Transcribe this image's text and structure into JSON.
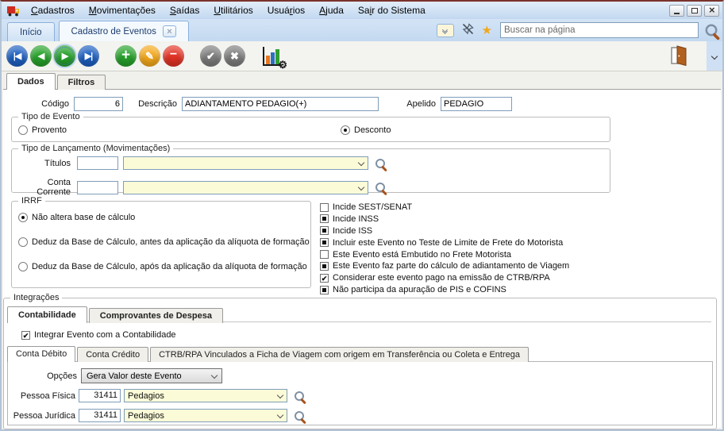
{
  "colors": {
    "window_border": "#7a332c",
    "titlebar_blue": "#cfe2f5",
    "link_navy": "#1c3d6e",
    "nav_blue": "#1d5fc0",
    "nav_green": "#27a12b",
    "edit_orange": "#f3a81c",
    "delete_red": "#e23325",
    "neutral_gray": "#7d7d7d",
    "input_yellow": "#fbfbd8",
    "star_gold": "#f2a71b",
    "door_brown": "#b0601f",
    "focus_blue": "#4472c4"
  },
  "titlebar": {
    "menu_items": [
      {
        "label": "Cadastros",
        "u": 0
      },
      {
        "label": "Movimentações",
        "u": 0
      },
      {
        "label": "Saídas",
        "u": 0
      },
      {
        "label": "Utilitários",
        "u": 0
      },
      {
        "label": "Usuários",
        "u": 4
      },
      {
        "label": "Ajuda",
        "u": 0
      },
      {
        "label": "Sair do Sistema",
        "u": 2
      }
    ],
    "window_controls": [
      "minimize",
      "restore",
      "close"
    ]
  },
  "tabbar": {
    "tabs": [
      {
        "label": "Início",
        "active": false
      },
      {
        "label": "Cadastro de Eventos",
        "active": true,
        "closable": true
      }
    ],
    "icons": [
      "tab-list-icon",
      "unpin-icon",
      "favorite-star-icon",
      "search-icon"
    ],
    "search_placeholder": "Buscar na página"
  },
  "toolbar": {
    "buttons": [
      {
        "name": "first-record-button",
        "style": "nav-blue",
        "glyph": "|◀"
      },
      {
        "name": "previous-record-button",
        "style": "nav-green",
        "glyph": "◀"
      },
      {
        "name": "next-record-button",
        "style": "nav-green",
        "glyph": "▶",
        "focused": true
      },
      {
        "name": "last-record-button",
        "style": "nav-blue",
        "glyph": "▶|"
      },
      {
        "name": "add-button",
        "style": "add-green gap",
        "glyph": "+"
      },
      {
        "name": "edit-button",
        "style": "edit-orange",
        "glyph": "✎"
      },
      {
        "name": "delete-button",
        "style": "delete-red",
        "glyph": "−"
      },
      {
        "name": "confirm-button",
        "style": "gray gap",
        "glyph": "✔"
      },
      {
        "name": "cancel-button",
        "style": "gray",
        "glyph": "✖"
      }
    ],
    "extra_icons": [
      "statistics-chart-icon",
      "exit-door-icon",
      "toolbar-overflow-dropdown"
    ]
  },
  "form": {
    "page_tabs": [
      {
        "label": "Dados",
        "active": true
      },
      {
        "label": "Filtros",
        "active": false
      }
    ],
    "fields": {
      "codigo": {
        "label": "Código",
        "value": "6"
      },
      "descricao": {
        "label": "Descrição",
        "value": "ADIANTAMENTO PEDAGIO(+)"
      },
      "apelido": {
        "label": "Apelido",
        "value": "PEDAGIO"
      }
    },
    "tipo_evento": {
      "legend": "Tipo de Evento",
      "options": [
        {
          "label": "Provento",
          "selected": false
        },
        {
          "label": "Desconto",
          "selected": true
        }
      ]
    },
    "tipo_lancamento": {
      "legend": "Tipo de Lançamento (Movimentações)",
      "rows": [
        {
          "label": "Títulos",
          "code": "",
          "value": ""
        },
        {
          "label": "Conta Corrente",
          "code": "",
          "value": ""
        }
      ]
    },
    "irrf": {
      "legend": "IRRF",
      "options": [
        {
          "label": "Não altera base de cálculo",
          "selected": true
        },
        {
          "label": "Deduz da Base de Cálculo, antes da aplicação da alíquota de formação",
          "selected": false
        },
        {
          "label": "Deduz da Base de Cálculo, após da aplicação da alíquota de formação",
          "selected": false
        }
      ]
    },
    "flags": [
      {
        "label": "Incide SEST/SENAT",
        "state": "unchecked"
      },
      {
        "label": "Incide INSS",
        "state": "square"
      },
      {
        "label": "Incide ISS",
        "state": "square"
      },
      {
        "label": "Incluir este Evento no Teste de Limite de Frete do Motorista",
        "state": "square"
      },
      {
        "label": "Este Evento está Embutido no Frete Motorista",
        "state": "unchecked"
      },
      {
        "label": "Este Evento faz parte do cálculo de adiantamento de Viagem",
        "state": "square"
      },
      {
        "label": "Considerar este evento pago na emissão de CTRB/RPA",
        "state": "checked"
      },
      {
        "label": "Não participa da apuração de PIS e COFINS",
        "state": "square"
      }
    ],
    "integracoes": {
      "legend": "Integrações",
      "tabs": [
        {
          "label": "Contabilidade",
          "active": true
        },
        {
          "label": "Comprovantes de Despesa",
          "active": false
        }
      ],
      "integrar_checkbox": {
        "label": "Integrar Evento com a Contabilidade",
        "state": "checked"
      },
      "conta_tabs": [
        {
          "label": "Conta Débito",
          "active": true
        },
        {
          "label": "Conta Crédito",
          "active": false
        },
        {
          "label": "CTRB/RPA Vinculados a Ficha de Viagem com origem em Transferência ou Coleta e Entrega",
          "active": false
        }
      ],
      "opcoes": {
        "label": "Opções",
        "value": "Gera Valor deste Evento"
      },
      "pessoa_fisica": {
        "label": "Pessoa Física",
        "code": "31411",
        "value": "Pedagios"
      },
      "pessoa_juridica": {
        "label": "Pessoa Jurídica",
        "code": "31411",
        "value": "Pedagios"
      }
    }
  }
}
